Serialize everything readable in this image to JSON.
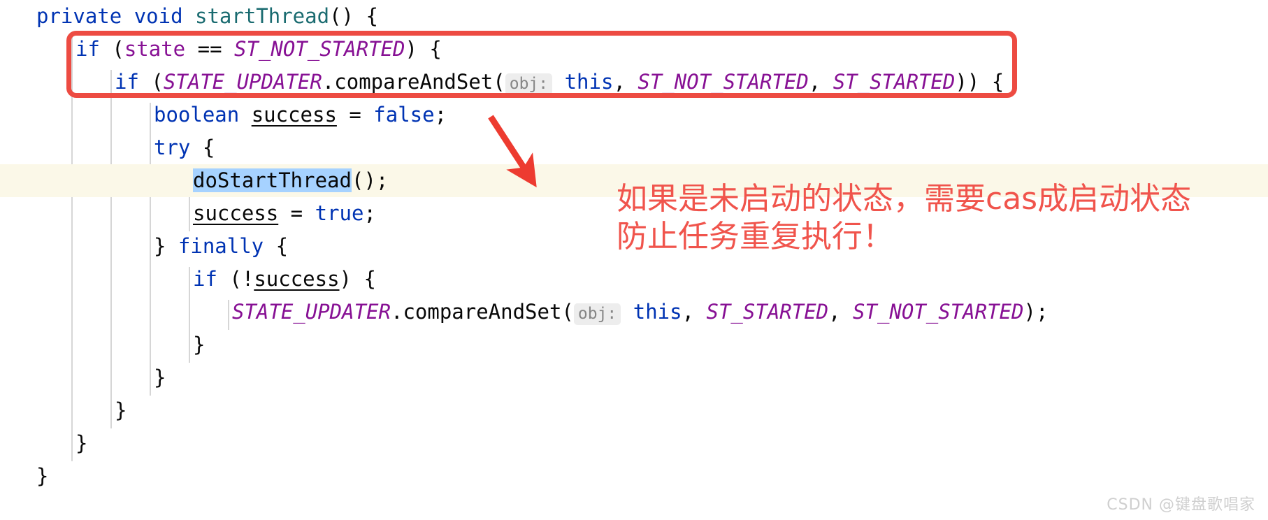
{
  "editor": {
    "language": "java",
    "font_size_px": 29,
    "background": "#ffffff",
    "highlight_line_background": "#fbf8e8",
    "selection_background": "#a6d2ff",
    "colors": {
      "keyword": "#0033b3",
      "method_declaration": "#1a6b70",
      "static_final_field": "#871094",
      "plain_text": "#080808",
      "parameter_hint": "#868686",
      "parameter_hint_background": "#ededed",
      "indent_guide": "#d6d6d6"
    },
    "lines": [
      {
        "id": "line-1",
        "indent": 0,
        "highlighted": false,
        "tokens": [
          {
            "t": "private",
            "k": "kw"
          },
          {
            "t": " ",
            "k": "plain"
          },
          {
            "t": "void",
            "k": "kw"
          },
          {
            "t": " ",
            "k": "plain"
          },
          {
            "t": "startThread",
            "k": "method"
          },
          {
            "t": "() {",
            "k": "plain"
          }
        ]
      },
      {
        "id": "line-2",
        "indent": 1,
        "highlighted": false,
        "tokens": [
          {
            "t": "if",
            "k": "kw"
          },
          {
            "t": " (",
            "k": "plain"
          },
          {
            "t": "state",
            "k": "field"
          },
          {
            "t": " == ",
            "k": "plain"
          },
          {
            "t": "ST_NOT_STARTED",
            "k": "static"
          },
          {
            "t": ") {",
            "k": "plain"
          }
        ]
      },
      {
        "id": "line-3",
        "indent": 2,
        "highlighted": false,
        "tokens": [
          {
            "t": "if",
            "k": "kw"
          },
          {
            "t": " (",
            "k": "plain"
          },
          {
            "t": "STATE_UPDATER",
            "k": "static"
          },
          {
            "t": ".compareAndSet(",
            "k": "plain"
          },
          {
            "t": "obj:",
            "k": "hint"
          },
          {
            "t": " ",
            "k": "plain"
          },
          {
            "t": "this",
            "k": "kw"
          },
          {
            "t": ", ",
            "k": "plain"
          },
          {
            "t": "ST_NOT_STARTED",
            "k": "static"
          },
          {
            "t": ", ",
            "k": "plain"
          },
          {
            "t": "ST_STARTED",
            "k": "static"
          },
          {
            "t": ")) {",
            "k": "plain"
          }
        ]
      },
      {
        "id": "line-4",
        "indent": 3,
        "highlighted": false,
        "tokens": [
          {
            "t": "boolean",
            "k": "kw"
          },
          {
            "t": " ",
            "k": "plain"
          },
          {
            "t": "success",
            "k": "local-u"
          },
          {
            "t": " = ",
            "k": "plain"
          },
          {
            "t": "false",
            "k": "kw"
          },
          {
            "t": ";",
            "k": "plain"
          }
        ]
      },
      {
        "id": "line-5",
        "indent": 3,
        "highlighted": false,
        "tokens": [
          {
            "t": "try",
            "k": "kw"
          },
          {
            "t": " {",
            "k": "plain"
          }
        ]
      },
      {
        "id": "line-6",
        "indent": 4,
        "highlighted": true,
        "tokens": [
          {
            "t": "doStartThread",
            "k": "sel"
          },
          {
            "t": "();",
            "k": "plain"
          }
        ]
      },
      {
        "id": "line-7",
        "indent": 4,
        "highlighted": false,
        "tokens": [
          {
            "t": "success",
            "k": "local-u"
          },
          {
            "t": " = ",
            "k": "plain"
          },
          {
            "t": "true",
            "k": "kw"
          },
          {
            "t": ";",
            "k": "plain"
          }
        ]
      },
      {
        "id": "line-8",
        "indent": 3,
        "highlighted": false,
        "tokens": [
          {
            "t": "} ",
            "k": "plain"
          },
          {
            "t": "finally",
            "k": "kw"
          },
          {
            "t": " {",
            "k": "plain"
          }
        ]
      },
      {
        "id": "line-9",
        "indent": 4,
        "highlighted": false,
        "tokens": [
          {
            "t": "if",
            "k": "kw"
          },
          {
            "t": " (!",
            "k": "plain"
          },
          {
            "t": "success",
            "k": "local-u"
          },
          {
            "t": ") {",
            "k": "plain"
          }
        ]
      },
      {
        "id": "line-10",
        "indent": 5,
        "highlighted": false,
        "tokens": [
          {
            "t": "STATE_UPDATER",
            "k": "static"
          },
          {
            "t": ".compareAndSet(",
            "k": "plain"
          },
          {
            "t": "obj:",
            "k": "hint"
          },
          {
            "t": " ",
            "k": "plain"
          },
          {
            "t": "this",
            "k": "kw"
          },
          {
            "t": ", ",
            "k": "plain"
          },
          {
            "t": "ST_STARTED",
            "k": "static"
          },
          {
            "t": ", ",
            "k": "plain"
          },
          {
            "t": "ST_NOT_STARTED",
            "k": "static"
          },
          {
            "t": ");",
            "k": "plain"
          }
        ]
      },
      {
        "id": "line-11",
        "indent": 4,
        "highlighted": false,
        "tokens": [
          {
            "t": "}",
            "k": "plain"
          }
        ]
      },
      {
        "id": "line-12",
        "indent": 3,
        "highlighted": false,
        "tokens": [
          {
            "t": "}",
            "k": "plain"
          }
        ]
      },
      {
        "id": "line-13",
        "indent": 2,
        "highlighted": false,
        "tokens": [
          {
            "t": "}",
            "k": "plain"
          }
        ]
      },
      {
        "id": "line-14",
        "indent": 1,
        "highlighted": false,
        "tokens": [
          {
            "t": "}",
            "k": "plain"
          }
        ]
      },
      {
        "id": "line-15",
        "indent": 0,
        "highlighted": false,
        "tokens": [
          {
            "t": "}",
            "k": "plain"
          }
        ]
      }
    ]
  },
  "annotations": {
    "color": "#ed4b42",
    "note_color": "#f0544c",
    "highlight_box": {
      "label": "red-rounded-rectangle around the two if conditions"
    },
    "arrow": {
      "label": "red arrow pointing down-right from box to note"
    },
    "note_lines": [
      "如果是未启动的状态，需要cas成启动状态",
      "防止任务重复执行！"
    ]
  },
  "watermark": {
    "text": "CSDN @键盘歌唱家",
    "color": "#cfcfcf"
  }
}
